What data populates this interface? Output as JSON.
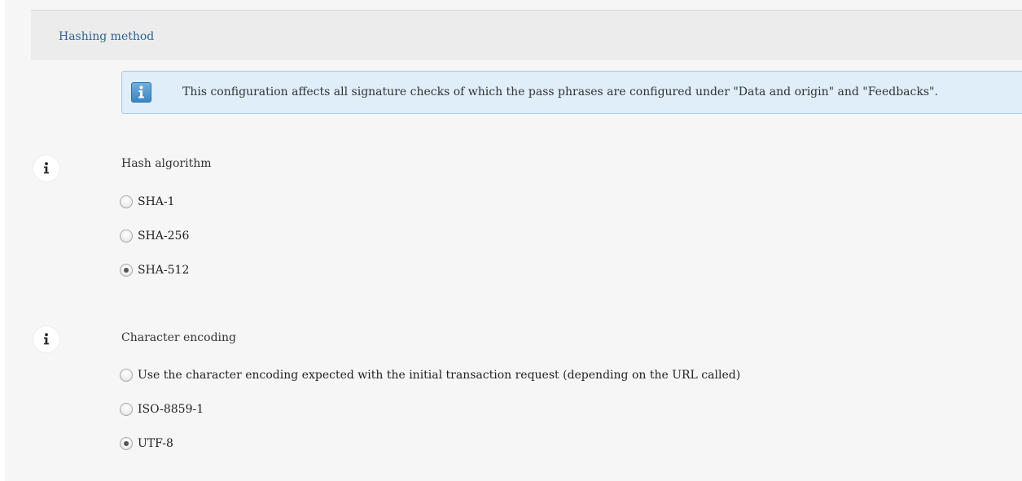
{
  "section": {
    "title": "Hashing method"
  },
  "info_box": {
    "icon": "info-icon",
    "text": "This configuration affects all signature checks of which the pass phrases are configured under \"Data and origin\" and \"Feedbacks\"."
  },
  "hash_algorithm": {
    "label": "Hash algorithm",
    "help_icon": "info-icon",
    "options": [
      {
        "label": "SHA-1",
        "selected": false
      },
      {
        "label": "SHA-256",
        "selected": false
      },
      {
        "label": "SHA-512",
        "selected": true
      }
    ]
  },
  "character_encoding": {
    "label": "Character encoding",
    "help_icon": "info-icon",
    "options": [
      {
        "label": "Use the character encoding expected with the initial transaction request (depending on the URL called)",
        "selected": false
      },
      {
        "label": "ISO-8859-1",
        "selected": false
      },
      {
        "label": "UTF-8",
        "selected": true
      }
    ]
  },
  "colors": {
    "link": "#2a6496",
    "info_box_bg": "#dfeef8",
    "info_box_border": "#a8cbe4",
    "page_bg": "#f6f6f6",
    "header_bg": "#ececec"
  }
}
